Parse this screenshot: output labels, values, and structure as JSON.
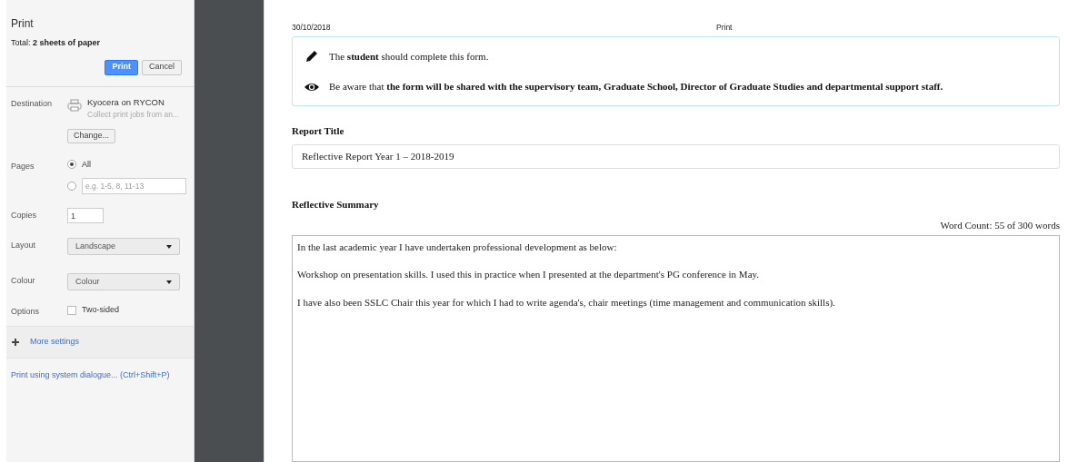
{
  "sidebar": {
    "title": "Print",
    "total": "Total: **2 sheets of paper**",
    "buttons": [
      {
        "label": "Print",
        "kind": "primary"
      },
      {
        "label": "Cancel",
        "kind": "secondary"
      }
    ],
    "destination": {
      "label": "Destination",
      "printer": "Kyocera on RYCON",
      "description": "Collect print jobs from an...",
      "button": "Change..."
    },
    "pages": {
      "label": "Pages",
      "options": [
        {
          "kind": "text",
          "text": "All",
          "selected": true
        },
        {
          "kind": "range",
          "placeholder": "e.g. 1-5, 8, 11-13",
          "selected": false
        }
      ]
    },
    "copies": {
      "label": "Copies",
      "value": "1"
    },
    "layout": {
      "label": "Layout",
      "value": "Landscape"
    },
    "colour": {
      "label": "Colour",
      "value": "Colour"
    },
    "options": {
      "label": "Options",
      "items": [
        {
          "label": "Two-sided",
          "checked": false
        }
      ]
    },
    "more_settings": "More settings",
    "system_dialog_link": "Print using system dialogue... (Ctrl+Shift+P)"
  },
  "preview": {
    "date": "30/10/2018",
    "header_title": "Print",
    "notices": [
      {
        "kind": "pencil",
        "text": "The **student** should complete this form."
      },
      {
        "kind": "eye",
        "text": "Be aware that **the form will be shared with the supervisory team, Graduate School, Director of Graduate Studies and departmental support staff.**"
      }
    ],
    "report_title": {
      "label": "Report Title",
      "value": "Reflective Report Year 1 – 2018-2019"
    },
    "summary": {
      "label": "Reflective Summary",
      "word_count": "Word Count: 55 of 300 words",
      "paragraphs": [
        "In the last academic year I have undertaken professional development as below:",
        "Workshop on presentation skills. I used this in practice when I presented at the department's PG conference in May.",
        "I have also been SSLC Chair this year for which I had to write agenda's, chair meetings (time management and communication skills)."
      ]
    }
  }
}
